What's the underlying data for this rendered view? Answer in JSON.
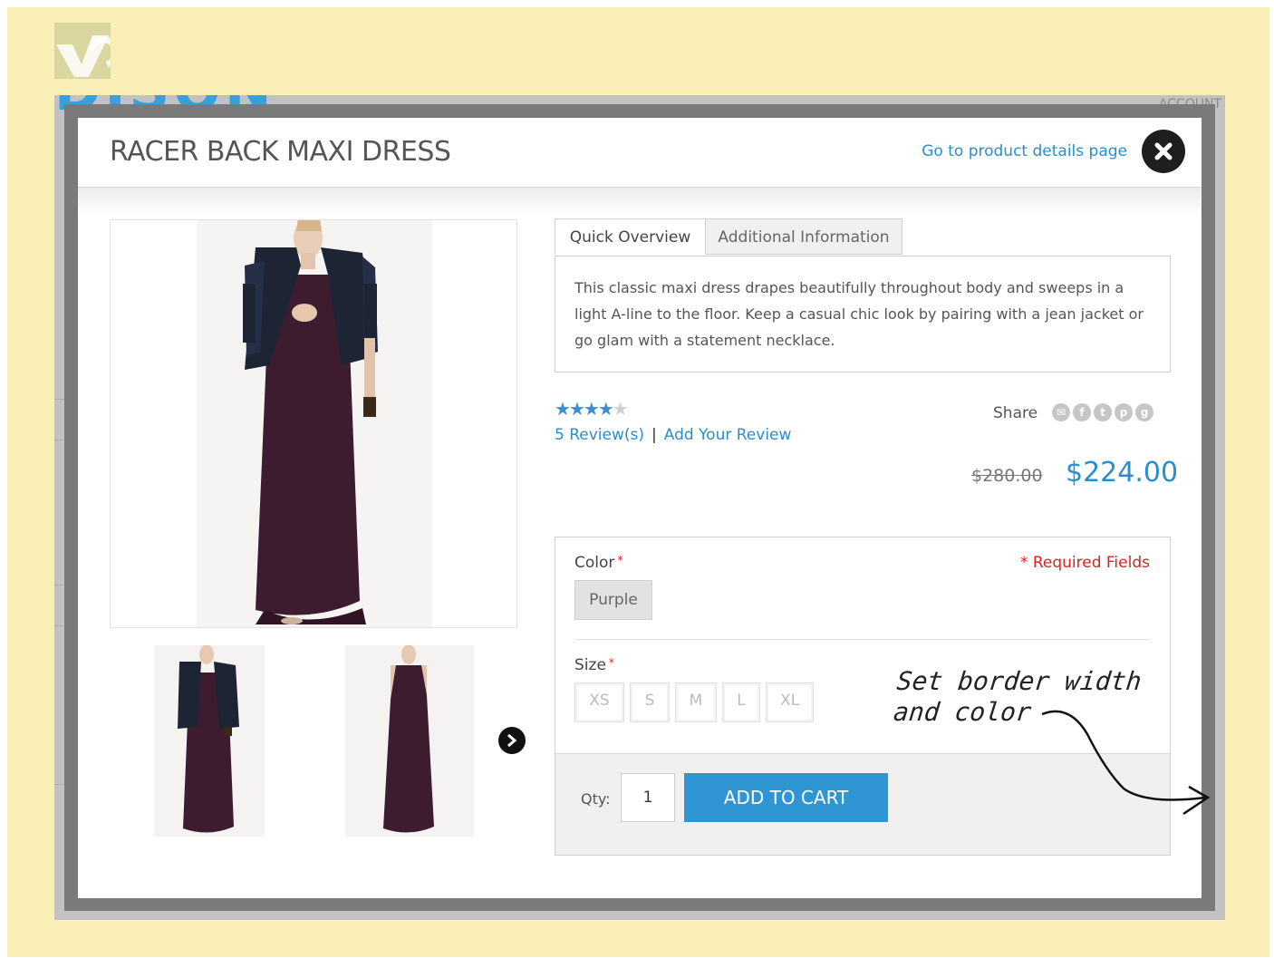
{
  "background": {
    "account_text": "ACCOUNT",
    "brand_partial": "DISON"
  },
  "modal": {
    "title": "RACER BACK MAXI DRESS",
    "details_link": "Go to product details page",
    "tabs": [
      {
        "label": "Quick Overview",
        "active": true
      },
      {
        "label": "Additional Information",
        "active": false
      }
    ],
    "description": "This classic maxi dress drapes beautifully throughout body and sweeps in a light A-line to the floor. Keep a casual chic look by pairing with a jean jacket or go glam with a statement necklace.",
    "rating": {
      "stars": 4,
      "max": 5
    },
    "reviews_link": "5 Review(s)",
    "review_separator": "|",
    "add_review_link": "Add Your Review",
    "share_label": "Share",
    "share_icons": [
      "email-icon",
      "facebook-icon",
      "twitter-icon",
      "pinterest-icon",
      "google-plus-icon"
    ],
    "old_price": "$280.00",
    "new_price": "$224.00",
    "options": {
      "color_label": "Color",
      "required_mark": "*",
      "required_fields": "* Required Fields",
      "color_value": "Purple",
      "size_label": "Size",
      "sizes": [
        "XS",
        "S",
        "M",
        "L",
        "XL"
      ]
    },
    "qty_label": "Qty:",
    "qty_value": "1",
    "add_to_cart": "ADD TO CART"
  },
  "annotation": {
    "line1": "Set border width",
    "line2": "and color"
  },
  "colors": {
    "accent": "#2f95d3",
    "link": "#2a8ecb",
    "frame": "#7a7a7a",
    "page_bg": "#f9efb6",
    "dress": "#3d1c30",
    "jacket": "#1d2535",
    "required": "#e02020"
  }
}
